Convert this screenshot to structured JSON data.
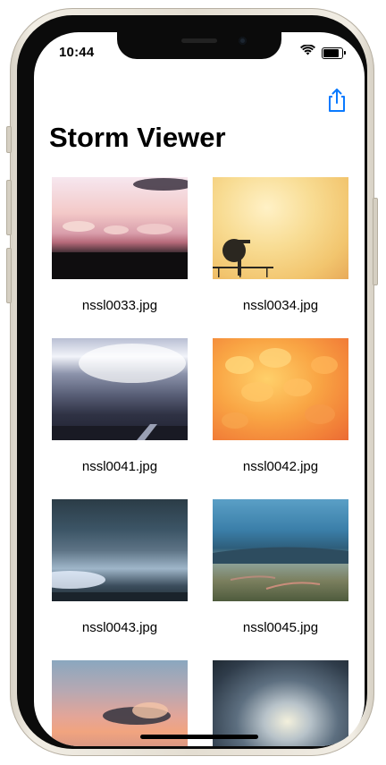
{
  "status_bar": {
    "time": "10:44",
    "icons": [
      "wifi-icon",
      "battery-icon"
    ],
    "battery_level": 0.85
  },
  "navigation": {
    "title": "Storm Viewer",
    "share_icon": "share-icon"
  },
  "images": [
    {
      "filename": "nssl0033.jpg"
    },
    {
      "filename": "nssl0034.jpg"
    },
    {
      "filename": "nssl0041.jpg"
    },
    {
      "filename": "nssl0042.jpg"
    },
    {
      "filename": "nssl0043.jpg"
    },
    {
      "filename": "nssl0045.jpg"
    },
    {
      "filename": ""
    },
    {
      "filename": ""
    }
  ],
  "colors": {
    "accent": "#0a7aff",
    "text": "#000000",
    "background": "#ffffff",
    "device_frame": "#ebe6da"
  }
}
